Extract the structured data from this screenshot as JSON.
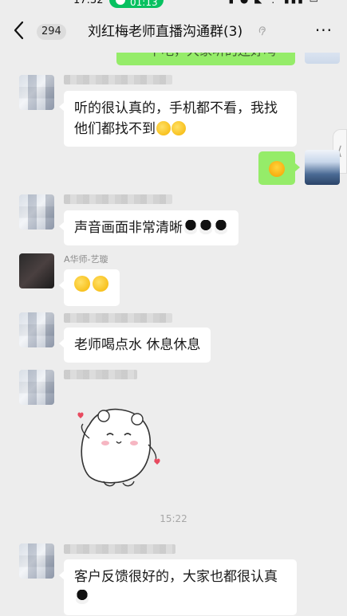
{
  "status_bar": {
    "time": "17:32",
    "call_time": "01:13",
    "icons": "▮ ● ◣ ⋮ ▮▮▮ ▭"
  },
  "header": {
    "back_icon": "chevron-left-icon",
    "unread_count": "294",
    "title": "刘红梅老师直播沟通群(3)",
    "mute_icon": "ear-icon",
    "more_icon": "more-dots-icon",
    "more_label": "···"
  },
  "messages": [
    {
      "id": "top-partial",
      "side": "self",
      "text": "一下吧，大家听的还好吗"
    },
    {
      "id": "m1",
      "side": "other",
      "text": "听的很认真的，手机都不看，我找\n他们都找不到",
      "emojis": 2,
      "emoji_style": "shy-face"
    },
    {
      "id": "m2",
      "side": "self",
      "emoji": "laugh-cry-face"
    },
    {
      "id": "m3",
      "side": "other",
      "text": "声音画面非常清晰",
      "emojis": 3,
      "emoji_style": "qq-penguin"
    },
    {
      "id": "m4",
      "side": "other",
      "nickname": "A华师-艺璇",
      "emojis": 2,
      "emoji_style": "shy-face"
    },
    {
      "id": "m5",
      "side": "other",
      "text": "老师喝点水 休息休息"
    },
    {
      "id": "m6",
      "side": "other",
      "sticker": "cute-white-bear-sticker"
    },
    {
      "id": "m7",
      "side": "other",
      "text": "客户反馈很好的，大家也都很认真",
      "emojis": 1,
      "emoji_style": "qq-penguin"
    }
  ],
  "time_separator": "15:22",
  "colors": {
    "background": "#ededed",
    "self_bubble": "#95ec69",
    "other_bubble": "#ffffff",
    "call_green": "#07c160"
  }
}
